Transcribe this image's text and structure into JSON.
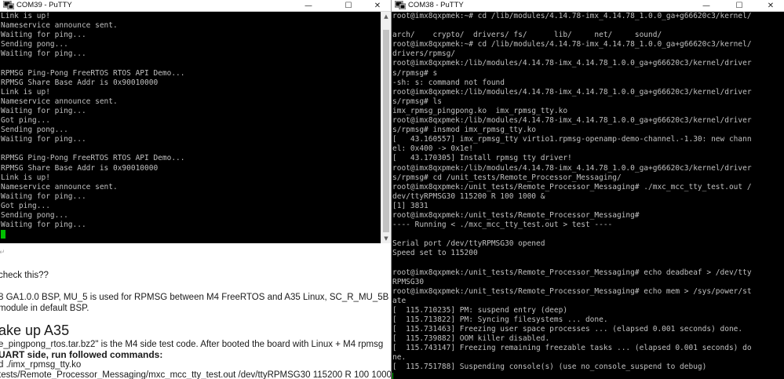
{
  "document": {
    "lines": [
      {
        "text": "",
        "type": "para"
      },
      {
        "text": "check this??",
        "type": "normal"
      },
      {
        "text": "8 GA1.0.0 BSP, MU_5 is used for RPMSG between M4 FreeRTOS and A35 Linux, SC_R_MU_5B",
        "type": "normal"
      },
      {
        "text": "module in default BSP.",
        "type": "normal"
      },
      {
        "text": "ake up A35",
        "type": "heading"
      },
      {
        "text": "e_pingpong_rtos.tar.bz2\" is the M4 side test code. After booted the board with Linux + M4 rpmsg",
        "type": "normal"
      },
      {
        "text": "UART side, run followed commands:",
        "type": "bold"
      },
      {
        "text": "d ./imx_rpmsg_tty.ko",
        "type": "normal"
      },
      {
        "text": "tests/Remote_Processor_Messaging/mxc_mcc_tty_test.out /dev/ttyRPMSG30 115200 R 100 1000",
        "type": "normal"
      }
    ]
  },
  "windows": {
    "left": {
      "title": "COM39 - PuTTY",
      "lines": [
        "Link is up!",
        "Nameservice announce sent.",
        "Waiting for ping...",
        "Sending pong...",
        "Waiting for ping...",
        "",
        "RPMSG Ping-Pong FreeRTOS RTOS API Demo...",
        "RPMSG Share Base Addr is 0x90010000",
        "Link is up!",
        "Nameservice announce sent.",
        "Waiting for ping...",
        "Got ping...",
        "Sending pong...",
        "Waiting for ping...",
        "",
        "RPMSG Ping-Pong FreeRTOS RTOS API Demo...",
        "RPMSG Share Base Addr is 0x90010000",
        "Link is up!",
        "Nameservice announce sent.",
        "Waiting for ping...",
        "Got ping...",
        "Sending pong...",
        "Waiting for ping..."
      ]
    },
    "right": {
      "title": "COM38 - PuTTY",
      "lines": [
        "root@imx8qxpmek:~# cd /lib/modules/4.14.78-imx_4.14.78_1.0.0_ga+g66620c3/kernel/",
        "",
        "arch/    crypto/  drivers/ fs/      lib/     net/     sound/",
        "root@imx8qxpmek:~# cd /lib/modules/4.14.78-imx_4.14.78_1.0.0_ga+g66620c3/kernel/",
        "drivers/rpmsg/",
        "root@imx8qxpmek:/lib/modules/4.14.78-imx_4.14.78_1.0.0_ga+g66620c3/kernel/driver",
        "s/rpmsg# s",
        "-sh: s: command not found",
        "root@imx8qxpmek:/lib/modules/4.14.78-imx_4.14.78_1.0.0_ga+g66620c3/kernel/driver",
        "s/rpmsg# ls",
        "imx_rpmsg_pingpong.ko  imx_rpmsg_tty.ko",
        "root@imx8qxpmek:/lib/modules/4.14.78-imx_4.14.78_1.0.0_ga+g66620c3/kernel/driver",
        "s/rpmsg# insmod imx_rpmsg_tty.ko",
        "[   43.160557] imx_rpmsg_tty virtio1.rpmsg-openamp-demo-channel.-1.30: new chann",
        "el: 0x400 -> 0x1e!",
        "[   43.170305] Install rpmsg tty driver!",
        "root@imx8qxpmek:/lib/modules/4.14.78-imx_4.14.78_1.0.0_ga+g66620c3/kernel/driver",
        "s/rpmsg# cd /unit_tests/Remote_Processor_Messaging/",
        "root@imx8qxpmek:/unit_tests/Remote_Processor_Messaging# ./mxc_mcc_tty_test.out /",
        "dev/ttyRPMSG30 115200 R 100 1000 &",
        "[1] 3831",
        "root@imx8qxpmek:/unit_tests/Remote_Processor_Messaging#",
        "---- Running < ./mxc_mcc_tty_test.out > test ----",
        "",
        "Serial port /dev/ttyRPMSG30 opened",
        "Speed set to 115200",
        "",
        "root@imx8qxpmek:/unit_tests/Remote_Processor_Messaging# echo deadbeaf > /dev/tty",
        "RPMSG30",
        "root@imx8qxpmek:/unit_tests/Remote_Processor_Messaging# echo mem > /sys/power/st",
        "ate",
        "[  115.710235] PM: suspend entry (deep)",
        "[  115.713822] PM: Syncing filesystems ... done.",
        "[  115.731463] Freezing user space processes ... (elapsed 0.001 seconds) done.",
        "[  115.739882] OOM killer disabled.",
        "[  115.743147] Freezing remaining freezable tasks ... (elapsed 0.001 seconds) do",
        "ne.",
        "[  115.751788] Suspending console(s) (use no_console_suspend to debug)"
      ]
    }
  },
  "window_controls": {
    "minimize": "—",
    "maximize": "☐",
    "close": "✕"
  },
  "scrollbar_arrows": {
    "up": "▲",
    "down": "▼"
  },
  "colors": {
    "terminal_bg": "#000000",
    "terminal_fg": "#c0c0c0",
    "cursor": "#00c000"
  }
}
